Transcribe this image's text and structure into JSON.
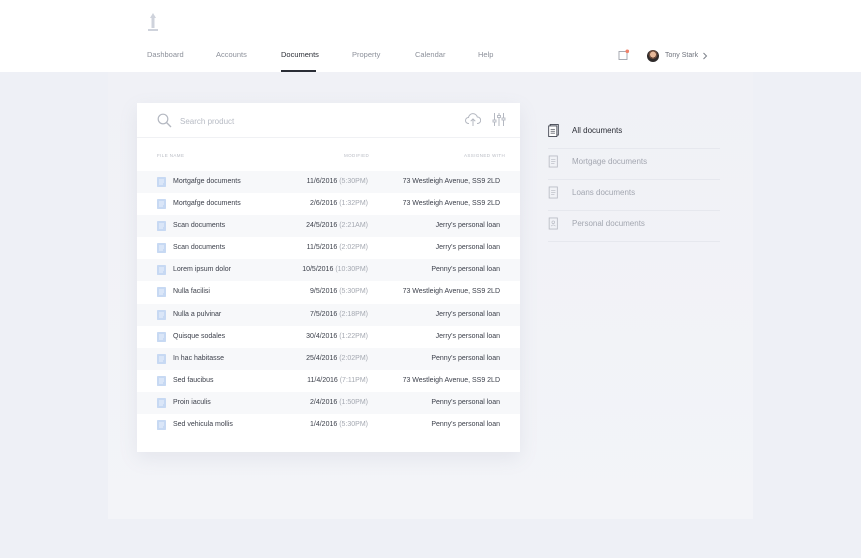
{
  "nav": {
    "items": [
      {
        "label": "Dashboard",
        "active": false
      },
      {
        "label": "Accounts",
        "active": false
      },
      {
        "label": "Documents",
        "active": true
      },
      {
        "label": "Property",
        "active": false
      },
      {
        "label": "Calendar",
        "active": false
      },
      {
        "label": "Help",
        "active": false
      }
    ]
  },
  "user": {
    "name": "Tony Stark"
  },
  "search": {
    "placeholder": "Search product"
  },
  "table": {
    "headers": {
      "file": "FILE NAME",
      "modified": "MODIFIED",
      "assoc": "ASSIGNED WITH"
    },
    "rows": [
      {
        "name": "Mortgafge documents",
        "date": "11/6/2016",
        "time": "(5:30PM)",
        "assoc": "73 Westleigh Avenue, SS9 2LD"
      },
      {
        "name": "Mortgafge documents",
        "date": "2/6/2016",
        "time": "(1:32PM)",
        "assoc": "73 Westleigh Avenue, SS9 2LD"
      },
      {
        "name": "Scan documents",
        "date": "24/5/2016",
        "time": "(2:21AM)",
        "assoc": "Jerry's personal loan"
      },
      {
        "name": "Scan documents",
        "date": "11/5/2016",
        "time": "(2:02PM)",
        "assoc": "Jerry's personal loan"
      },
      {
        "name": "Lorem ipsum dolor",
        "date": "10/5/2016",
        "time": "(10:30PM)",
        "assoc": "Penny's personal loan"
      },
      {
        "name": "Nulla facilisi",
        "date": "9/5/2016",
        "time": "(5:30PM)",
        "assoc": "73 Westleigh Avenue, SS9 2LD"
      },
      {
        "name": "Nulla a pulvinar",
        "date": "7/5/2016",
        "time": "(2:18PM)",
        "assoc": "Jerry's personal loan"
      },
      {
        "name": "Quisque sodales",
        "date": "30/4/2016",
        "time": "(1:22PM)",
        "assoc": "Jerry's personal loan"
      },
      {
        "name": "In hac habitasse",
        "date": "25/4/2016",
        "time": "(2:02PM)",
        "assoc": "Penny's personal loan"
      },
      {
        "name": "Sed faucibus",
        "date": "11/4/2016",
        "time": "(7:11PM)",
        "assoc": "73 Westleigh Avenue, SS9 2LD"
      },
      {
        "name": "Proin iaculis",
        "date": "2/4/2016",
        "time": "(1:50PM)",
        "assoc": "Penny's personal loan"
      },
      {
        "name": "Sed vehicula mollis",
        "date": "1/4/2016",
        "time": "(5:30PM)",
        "assoc": "Penny's personal loan"
      }
    ]
  },
  "side": {
    "items": [
      {
        "label": "All documents",
        "icon": "documents-stack-icon",
        "active": true
      },
      {
        "label": "Mortgage documents",
        "icon": "document-icon",
        "active": false
      },
      {
        "label": "Loans documents",
        "icon": "document-icon",
        "active": false
      },
      {
        "label": "Personal documents",
        "icon": "personal-document-icon",
        "active": false
      }
    ]
  },
  "colors": {
    "accent": "#2a2d35",
    "file_icon": "#c7d9f3",
    "muted": "#a3a7b0"
  }
}
